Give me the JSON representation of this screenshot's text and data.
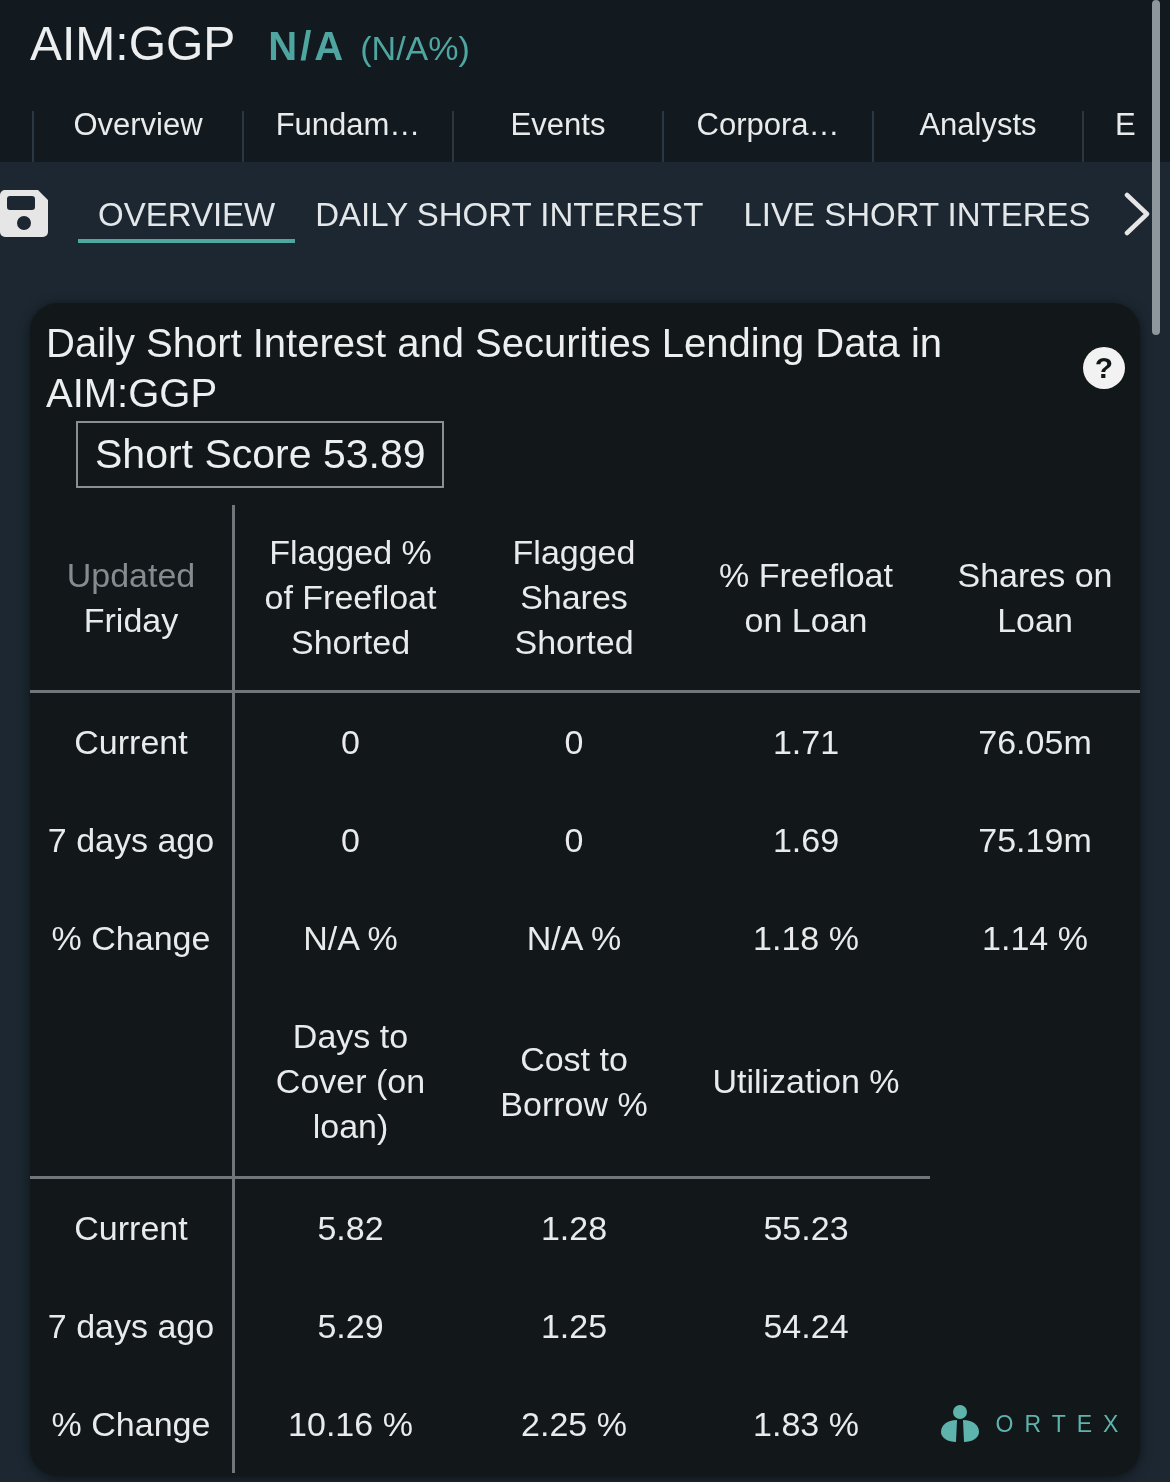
{
  "header": {
    "symbol": "AIM:GGP",
    "price": "N/A",
    "change": "(N/A%)"
  },
  "tabs": [
    {
      "label": "Overview"
    },
    {
      "label": "Fundam…"
    },
    {
      "label": "Events"
    },
    {
      "label": "Corpora…"
    },
    {
      "label": "Analysts"
    },
    {
      "label": "E"
    }
  ],
  "subtabs": [
    {
      "label": "OVERVIEW",
      "selected": true
    },
    {
      "label": "DAILY SHORT INTEREST",
      "selected": false
    },
    {
      "label": "LIVE SHORT INTERES",
      "selected": false
    }
  ],
  "card": {
    "title": "Daily Short Interest and Securities Lending Data in AIM:GGP",
    "help": "?",
    "short_score": "Short Score 53.89",
    "table": {
      "sections": [
        {
          "corner": {
            "label": "Updated",
            "day": "Friday"
          },
          "columns": [
            "Flagged % of Freefloat Shorted",
            "Flagged Shares Shorted",
            "% Freefloat on Loan",
            "Shares on Loan"
          ],
          "rows": [
            {
              "label": "Current",
              "values": [
                "0",
                "0",
                "1.71",
                "76.05m"
              ]
            },
            {
              "label": "7 days ago",
              "values": [
                "0",
                "0",
                "1.69",
                "75.19m"
              ]
            },
            {
              "label": "% Change",
              "values": [
                "N/A %",
                "N/A %",
                "1.18 %",
                "1.14 %"
              ]
            }
          ]
        },
        {
          "columns": [
            "Days to Cover (on loan)",
            "Cost to Borrow %",
            "Utilization %"
          ],
          "rows": [
            {
              "label": "Current",
              "values": [
                "5.82",
                "1.28",
                "55.23"
              ]
            },
            {
              "label": "7 days ago",
              "values": [
                "5.29",
                "1.25",
                "54.24"
              ]
            },
            {
              "label": "% Change",
              "values": [
                "10.16 %",
                "2.25 %",
                "1.83 %"
              ]
            }
          ]
        }
      ]
    },
    "logo": "ORTEX"
  }
}
